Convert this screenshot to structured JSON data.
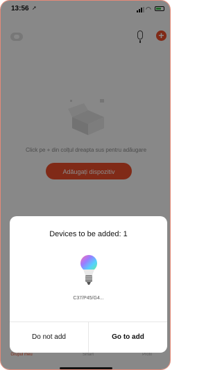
{
  "status_bar": {
    "time": "13:56",
    "location_glyph": "➚"
  },
  "icons": {
    "home": "home-selector-icon",
    "mic": "microphone-icon",
    "add": "plus-icon"
  },
  "header": {
    "add_symbol": "+"
  },
  "empty_state": {
    "message": "Click pe + din colțul dreapta sus pentru adăugare",
    "button_label": "Adăugați dispozitiv"
  },
  "tabs": [
    {
      "label": "Grupul meu",
      "active": true
    },
    {
      "label": "Smart",
      "active": false
    },
    {
      "label": "Profil",
      "active": false
    }
  ],
  "dialog": {
    "title": "Devices to be added: 1",
    "device_name": "C37/P45/G4...",
    "cancel_label": "Do not add",
    "confirm_label": "Go to add"
  },
  "colors": {
    "accent": "#e94e2b",
    "frame": "#e58a78"
  }
}
